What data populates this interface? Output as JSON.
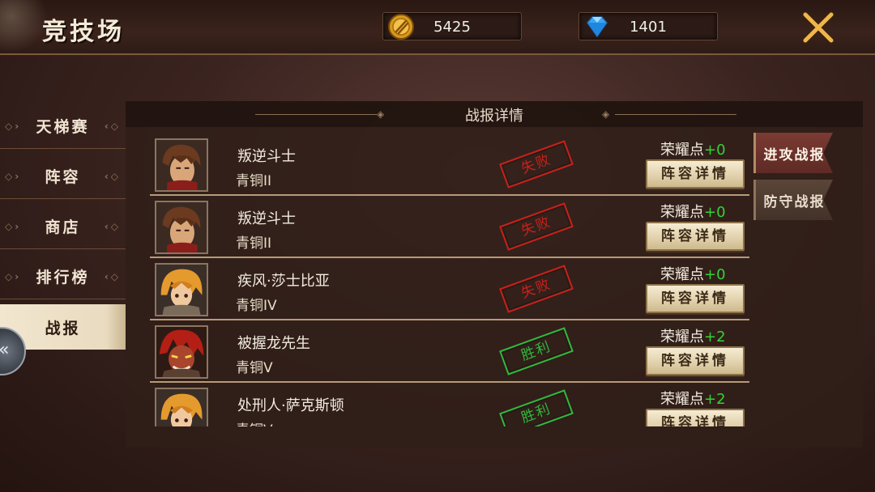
{
  "header": {
    "title": "竞技场",
    "gold": "5425",
    "diamonds": "1401"
  },
  "sidebar": {
    "items": [
      {
        "label": "天梯赛",
        "active": false
      },
      {
        "label": "阵容",
        "active": false
      },
      {
        "label": "商店",
        "active": false
      },
      {
        "label": "排行榜",
        "active": false
      },
      {
        "label": "战报",
        "active": true
      }
    ]
  },
  "panel": {
    "title": "战报详情",
    "honor_label": "荣耀点",
    "detail_button": "阵容详情",
    "rows": [
      {
        "name": "叛逆斗士",
        "rank": "青铜II",
        "result": "失败",
        "honor": "+0",
        "avatar": "brown-hair-warrior"
      },
      {
        "name": "叛逆斗士",
        "rank": "青铜II",
        "result": "失败",
        "honor": "+0",
        "avatar": "brown-hair-warrior"
      },
      {
        "name": "疾风·莎士比亚",
        "rank": "青铜IV",
        "result": "失败",
        "honor": "+0",
        "avatar": "blonde-hero"
      },
      {
        "name": "被握龙先生",
        "rank": "青铜V",
        "result": "胜利",
        "honor": "+2",
        "avatar": "red-beast"
      },
      {
        "name": "处刑人·萨克斯顿",
        "rank": "青铜V",
        "result": "胜利",
        "honor": "+2",
        "avatar": "blonde-hero"
      }
    ]
  },
  "right_tabs": [
    {
      "label": "进攻战报",
      "active": true
    },
    {
      "label": "防守战报",
      "active": false
    }
  ],
  "colors": {
    "lose": "#c8211b",
    "win": "#2fb93c",
    "honor_plus": "#35d235"
  }
}
